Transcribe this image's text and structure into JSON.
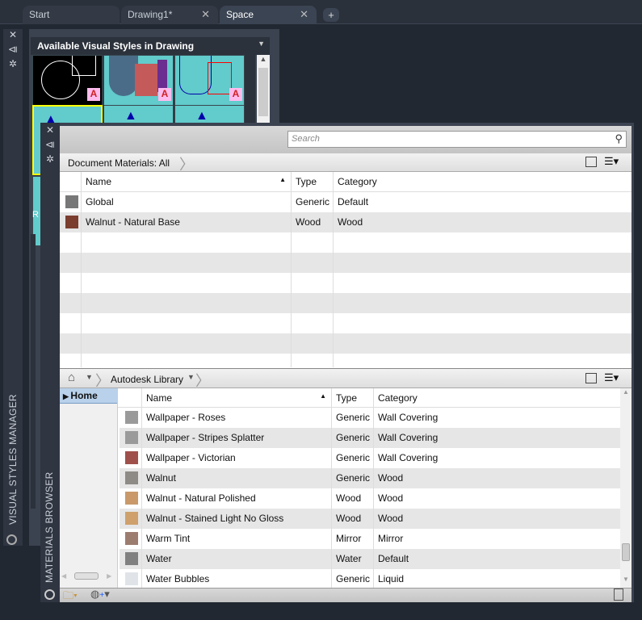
{
  "tabs": [
    {
      "label": "Start"
    },
    {
      "label": "Drawing1*",
      "close": "✕"
    },
    {
      "label": "Space",
      "close": "✕"
    }
  ],
  "new_tab": "+",
  "vsm": {
    "title": "VISUAL STYLES MANAGER",
    "header": "Available Visual Styles in Drawing",
    "partial_label": "R"
  },
  "mb": {
    "title": "MATERIALS BROWSER",
    "search_placeholder": "Search",
    "doc_crumb": "Document Materials: All",
    "doc_columns": [
      "Name",
      "Type",
      "Category"
    ],
    "doc_rows": [
      {
        "name": "Global",
        "type": "Generic",
        "category": "Default",
        "color": "#777"
      },
      {
        "name": "Walnut - Natural Base",
        "type": "Wood",
        "category": "Wood",
        "color": "#7a3d2e"
      }
    ],
    "lib_crumb": "Autodesk Library",
    "tree_home": "Home",
    "lib_columns": [
      "Name",
      "Type",
      "Category"
    ],
    "lib_rows": [
      {
        "name": "Wallpaper - Roses",
        "type": "Generic",
        "category": "Wall Covering",
        "color": "#9a9a9a"
      },
      {
        "name": "Wallpaper - Stripes Splatter",
        "type": "Generic",
        "category": "Wall Covering",
        "color": "#9a9a9a"
      },
      {
        "name": "Wallpaper - Victorian",
        "type": "Generic",
        "category": "Wall Covering",
        "color": "#a0504a"
      },
      {
        "name": "Walnut",
        "type": "Generic",
        "category": "Wood",
        "color": "#8e8a86"
      },
      {
        "name": "Walnut - Natural Polished",
        "type": "Wood",
        "category": "Wood",
        "color": "#c9996a"
      },
      {
        "name": "Walnut - Stained Light No Gloss",
        "type": "Wood",
        "category": "Wood",
        "color": "#cfa06c"
      },
      {
        "name": "Warm Tint",
        "type": "Mirror",
        "category": "Mirror",
        "color": "#9d7c70"
      },
      {
        "name": "Water",
        "type": "Water",
        "category": "Default",
        "color": "#808080"
      },
      {
        "name": "Water Bubbles",
        "type": "Generic",
        "category": "Liquid",
        "color": "#e0e4e8"
      }
    ]
  }
}
